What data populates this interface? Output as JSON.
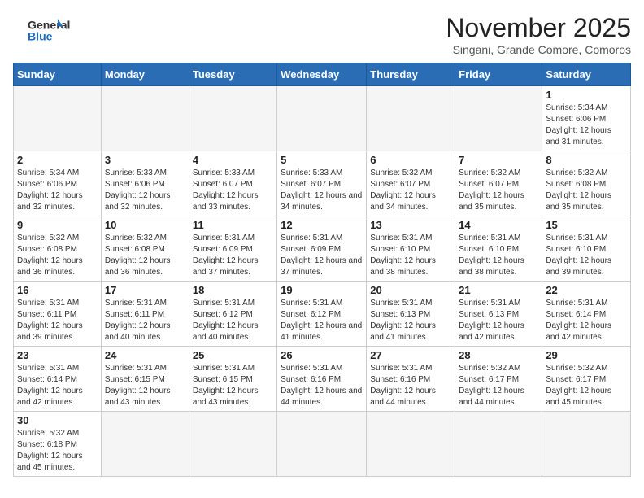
{
  "header": {
    "logo_general": "General",
    "logo_blue": "Blue",
    "month_title": "November 2025",
    "subtitle": "Singani, Grande Comore, Comoros"
  },
  "days_of_week": [
    "Sunday",
    "Monday",
    "Tuesday",
    "Wednesday",
    "Thursday",
    "Friday",
    "Saturday"
  ],
  "weeks": [
    [
      {
        "day": "",
        "info": ""
      },
      {
        "day": "",
        "info": ""
      },
      {
        "day": "",
        "info": ""
      },
      {
        "day": "",
        "info": ""
      },
      {
        "day": "",
        "info": ""
      },
      {
        "day": "",
        "info": ""
      },
      {
        "day": "1",
        "info": "Sunrise: 5:34 AM\nSunset: 6:06 PM\nDaylight: 12 hours and 31 minutes."
      }
    ],
    [
      {
        "day": "2",
        "info": "Sunrise: 5:34 AM\nSunset: 6:06 PM\nDaylight: 12 hours and 32 minutes."
      },
      {
        "day": "3",
        "info": "Sunrise: 5:33 AM\nSunset: 6:06 PM\nDaylight: 12 hours and 32 minutes."
      },
      {
        "day": "4",
        "info": "Sunrise: 5:33 AM\nSunset: 6:07 PM\nDaylight: 12 hours and 33 minutes."
      },
      {
        "day": "5",
        "info": "Sunrise: 5:33 AM\nSunset: 6:07 PM\nDaylight: 12 hours and 34 minutes."
      },
      {
        "day": "6",
        "info": "Sunrise: 5:32 AM\nSunset: 6:07 PM\nDaylight: 12 hours and 34 minutes."
      },
      {
        "day": "7",
        "info": "Sunrise: 5:32 AM\nSunset: 6:07 PM\nDaylight: 12 hours and 35 minutes."
      },
      {
        "day": "8",
        "info": "Sunrise: 5:32 AM\nSunset: 6:08 PM\nDaylight: 12 hours and 35 minutes."
      }
    ],
    [
      {
        "day": "9",
        "info": "Sunrise: 5:32 AM\nSunset: 6:08 PM\nDaylight: 12 hours and 36 minutes."
      },
      {
        "day": "10",
        "info": "Sunrise: 5:32 AM\nSunset: 6:08 PM\nDaylight: 12 hours and 36 minutes."
      },
      {
        "day": "11",
        "info": "Sunrise: 5:31 AM\nSunset: 6:09 PM\nDaylight: 12 hours and 37 minutes."
      },
      {
        "day": "12",
        "info": "Sunrise: 5:31 AM\nSunset: 6:09 PM\nDaylight: 12 hours and 37 minutes."
      },
      {
        "day": "13",
        "info": "Sunrise: 5:31 AM\nSunset: 6:10 PM\nDaylight: 12 hours and 38 minutes."
      },
      {
        "day": "14",
        "info": "Sunrise: 5:31 AM\nSunset: 6:10 PM\nDaylight: 12 hours and 38 minutes."
      },
      {
        "day": "15",
        "info": "Sunrise: 5:31 AM\nSunset: 6:10 PM\nDaylight: 12 hours and 39 minutes."
      }
    ],
    [
      {
        "day": "16",
        "info": "Sunrise: 5:31 AM\nSunset: 6:11 PM\nDaylight: 12 hours and 39 minutes."
      },
      {
        "day": "17",
        "info": "Sunrise: 5:31 AM\nSunset: 6:11 PM\nDaylight: 12 hours and 40 minutes."
      },
      {
        "day": "18",
        "info": "Sunrise: 5:31 AM\nSunset: 6:12 PM\nDaylight: 12 hours and 40 minutes."
      },
      {
        "day": "19",
        "info": "Sunrise: 5:31 AM\nSunset: 6:12 PM\nDaylight: 12 hours and 41 minutes."
      },
      {
        "day": "20",
        "info": "Sunrise: 5:31 AM\nSunset: 6:13 PM\nDaylight: 12 hours and 41 minutes."
      },
      {
        "day": "21",
        "info": "Sunrise: 5:31 AM\nSunset: 6:13 PM\nDaylight: 12 hours and 42 minutes."
      },
      {
        "day": "22",
        "info": "Sunrise: 5:31 AM\nSunset: 6:14 PM\nDaylight: 12 hours and 42 minutes."
      }
    ],
    [
      {
        "day": "23",
        "info": "Sunrise: 5:31 AM\nSunset: 6:14 PM\nDaylight: 12 hours and 42 minutes."
      },
      {
        "day": "24",
        "info": "Sunrise: 5:31 AM\nSunset: 6:15 PM\nDaylight: 12 hours and 43 minutes."
      },
      {
        "day": "25",
        "info": "Sunrise: 5:31 AM\nSunset: 6:15 PM\nDaylight: 12 hours and 43 minutes."
      },
      {
        "day": "26",
        "info": "Sunrise: 5:31 AM\nSunset: 6:16 PM\nDaylight: 12 hours and 44 minutes."
      },
      {
        "day": "27",
        "info": "Sunrise: 5:31 AM\nSunset: 6:16 PM\nDaylight: 12 hours and 44 minutes."
      },
      {
        "day": "28",
        "info": "Sunrise: 5:32 AM\nSunset: 6:17 PM\nDaylight: 12 hours and 44 minutes."
      },
      {
        "day": "29",
        "info": "Sunrise: 5:32 AM\nSunset: 6:17 PM\nDaylight: 12 hours and 45 minutes."
      }
    ],
    [
      {
        "day": "30",
        "info": "Sunrise: 5:32 AM\nSunset: 6:18 PM\nDaylight: 12 hours and 45 minutes."
      },
      {
        "day": "",
        "info": ""
      },
      {
        "day": "",
        "info": ""
      },
      {
        "day": "",
        "info": ""
      },
      {
        "day": "",
        "info": ""
      },
      {
        "day": "",
        "info": ""
      },
      {
        "day": "",
        "info": ""
      }
    ]
  ]
}
